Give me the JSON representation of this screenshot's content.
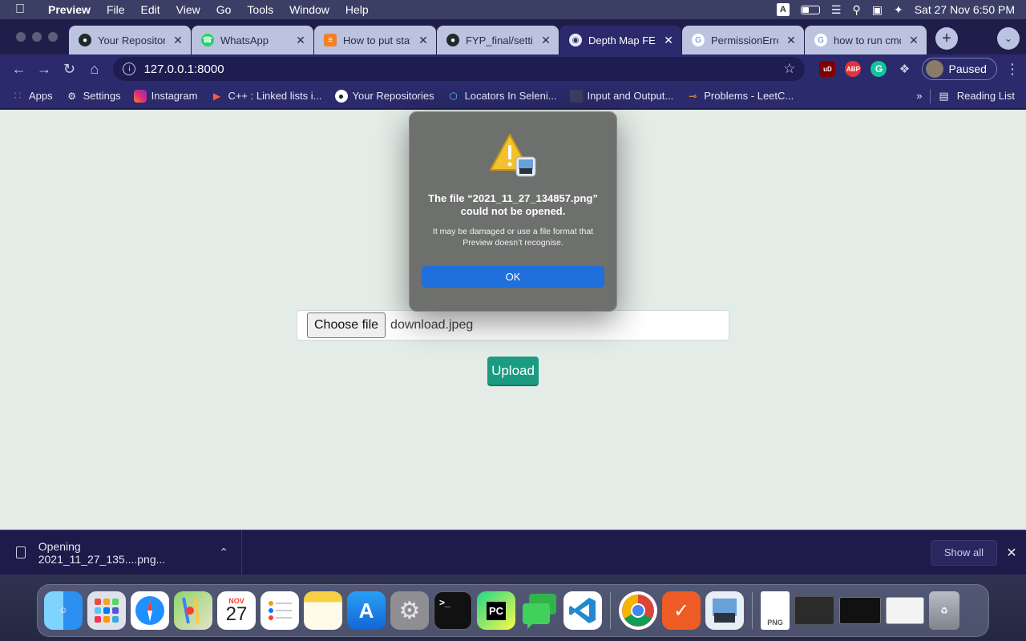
{
  "menubar": {
    "app_name": "Preview",
    "items": [
      "File",
      "Edit",
      "View",
      "Go",
      "Tools",
      "Window",
      "Help"
    ],
    "input_source": "A",
    "datetime": "Sat 27 Nov  6:50 PM"
  },
  "tabs": [
    {
      "title": "Your Repositori",
      "icon": "github-icon",
      "active": false
    },
    {
      "title": "WhatsApp",
      "icon": "whatsapp-icon",
      "active": false
    },
    {
      "title": "How to put stat",
      "icon": "stackoverflow-icon",
      "active": false
    },
    {
      "title": "FYP_final/settin",
      "icon": "github-icon",
      "active": false
    },
    {
      "title": "Depth Map FE",
      "icon": "globe-icon",
      "active": true
    },
    {
      "title": "PermissionErro",
      "icon": "google-icon",
      "active": false
    },
    {
      "title": "how to run cmd",
      "icon": "google-icon",
      "active": false
    }
  ],
  "toolbar": {
    "url": "127.0.0.1:8000",
    "profile_label": "Paused",
    "extensions": [
      "uBlock",
      "ABP",
      "Grammarly"
    ]
  },
  "bookmarks": {
    "items": [
      {
        "label": "Apps",
        "icon": "apps-grid-icon"
      },
      {
        "label": "Settings",
        "icon": "gear-icon"
      },
      {
        "label": "Instagram",
        "icon": "instagram-icon"
      },
      {
        "label": "C++ : Linked lists i...",
        "icon": "cpp-icon"
      },
      {
        "label": "Your Repositories",
        "icon": "github-icon"
      },
      {
        "label": "Locators In Seleni...",
        "icon": "selenium-icon"
      },
      {
        "label": "Input and Output...",
        "icon": "doc-icon"
      },
      {
        "label": "Problems - LeetC...",
        "icon": "leetcode-icon"
      }
    ],
    "overflow": "»",
    "reading_list": "Reading List"
  },
  "page": {
    "choose_file_label": "Choose file",
    "file_name": "download.jpeg",
    "upload_label": "Upload"
  },
  "dialog": {
    "title": "The file “2021_11_27_134857.png” could not be opened.",
    "message": "It may be damaged or use a file format that Preview doesn’t recognise.",
    "ok_label": "OK"
  },
  "downloads": {
    "item_label": "Opening 2021_11_27_135....png...",
    "show_all_label": "Show all"
  },
  "dock": {
    "calendar_month": "NOV",
    "calendar_day": "27",
    "apps": [
      "Finder",
      "Launchpad",
      "Safari",
      "Maps",
      "Calendar",
      "Reminders",
      "Notes",
      "App Store",
      "System Preferences",
      "Terminal",
      "PyCharm",
      "Messages",
      "VS Code",
      "Chrome",
      "Postman",
      "Preview"
    ]
  },
  "colors": {
    "page_bg": "#e4ece8",
    "upload_button": "#1a9b82",
    "dialog_ok": "#1f6fdc",
    "chrome_frame": "#2a2a6c"
  }
}
